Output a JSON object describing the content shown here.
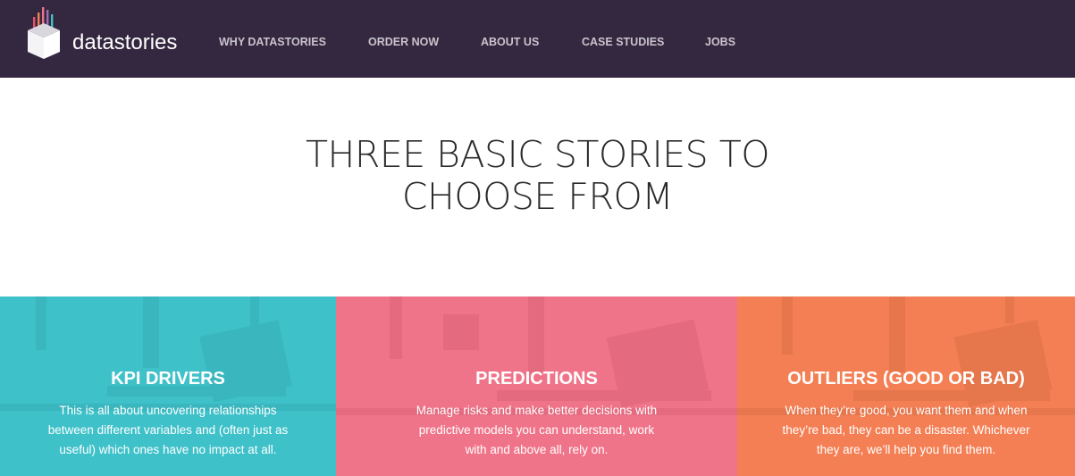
{
  "header": {
    "logo": {
      "text_light": "data",
      "text_bold": "stories",
      "icon": "book-chart-icon"
    },
    "nav": [
      {
        "label": "WHY DATASTORIES"
      },
      {
        "label": "ORDER NOW"
      },
      {
        "label": "ABOUT US"
      },
      {
        "label": "CASE STUDIES"
      },
      {
        "label": "JOBS"
      }
    ]
  },
  "hero": {
    "heading_line1": "THREE BASIC STORIES TO",
    "heading_line2": "CHOOSE FROM"
  },
  "panels": [
    {
      "title": "KPI DRIVERS",
      "lines": [
        "This is all about uncovering relationships",
        "between different variables and (often just as",
        "useful) which ones have no impact at all."
      ],
      "color": "#3fc1c9"
    },
    {
      "title": "PREDICTIONS",
      "lines": [
        "Manage risks and make better decisions with",
        "predictive models you can understand, work",
        "with and above all, rely on."
      ],
      "color": "#f07489"
    },
    {
      "title": "OUTLIERS (GOOD OR BAD)",
      "lines": [
        "When they’re good, you want them and when",
        "they’re bad, they can be a disaster. Whichever",
        "they are, we’ll help you find them."
      ],
      "color": "#f47f54"
    }
  ],
  "colors": {
    "navbar": "#342840",
    "nav_text": "#c8c4cc"
  }
}
